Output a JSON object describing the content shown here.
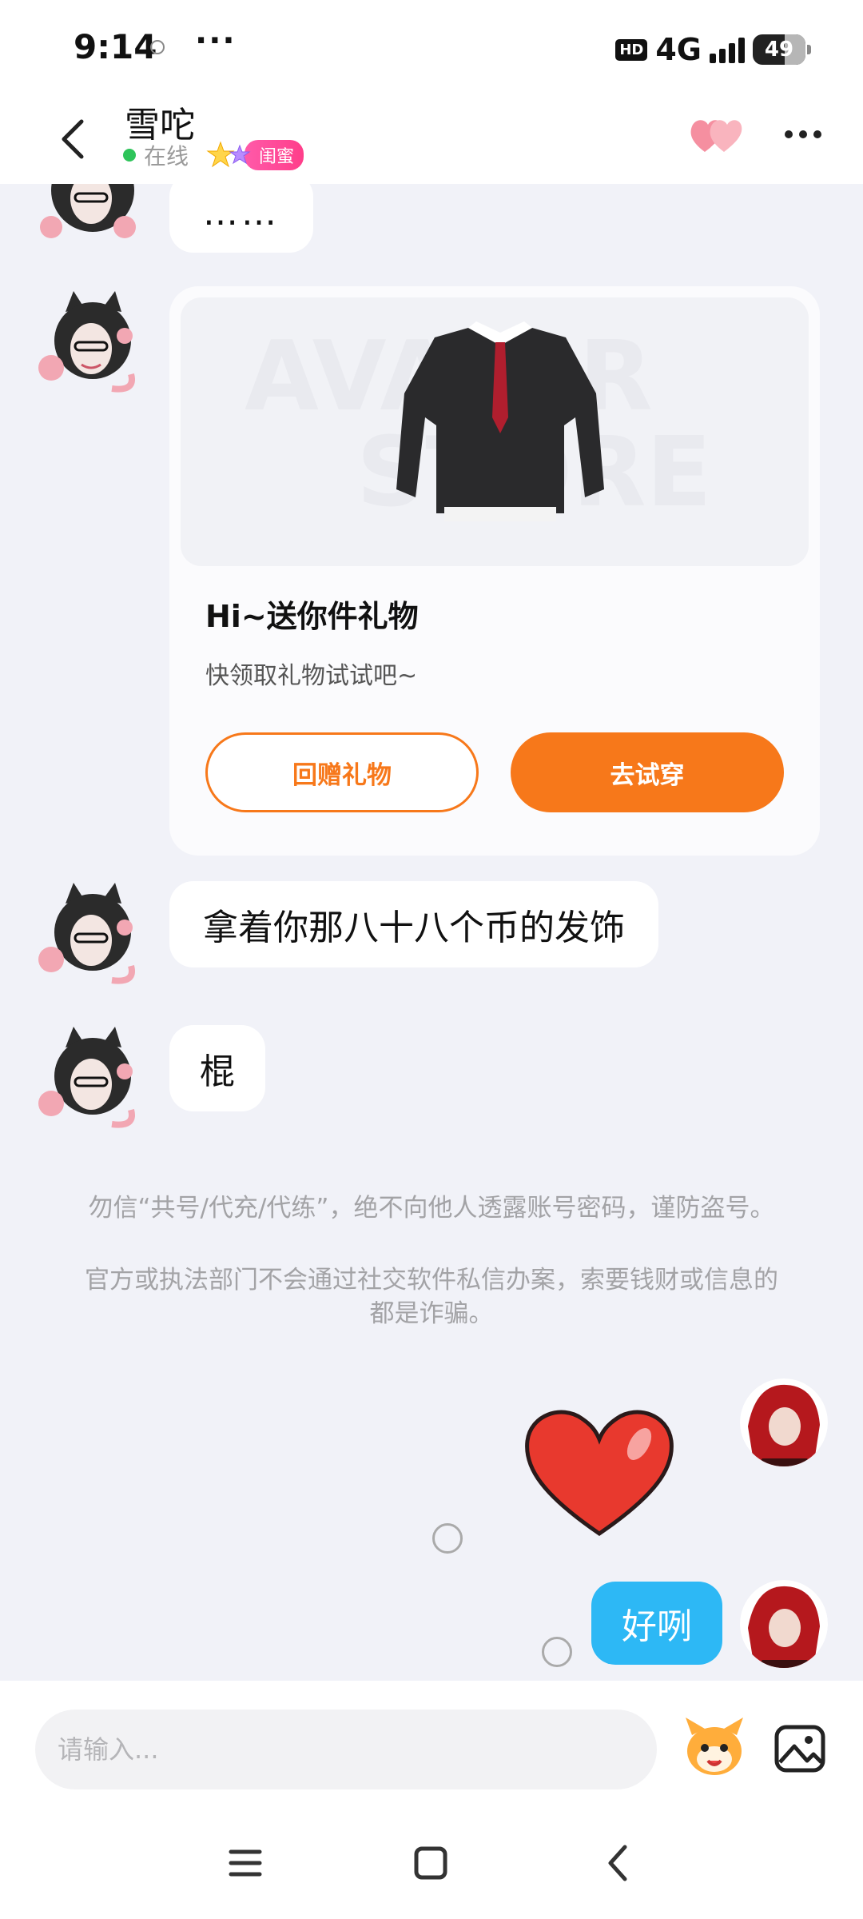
{
  "status_bar": {
    "time": "9:14",
    "hd": "HD",
    "network": "4G",
    "battery": "49"
  },
  "header": {
    "name": "雪咜",
    "status": "在线",
    "badge": "闺蜜"
  },
  "messages": {
    "ellipsis": "……",
    "gift_card": {
      "title": "Hi~送你件礼物",
      "description": "快领取礼物试试吧~",
      "return_gift_label": "回赠礼物",
      "try_on_label": "去试穿"
    },
    "text_1": "拿着你那八十八个币的发饰",
    "text_2": "棍",
    "mine_text": "好咧"
  },
  "notices": {
    "line_1": "勿信“共号/代充/代练”，绝不向他人透露账号密码，谨防盗号。",
    "line_2": "官方或执法部门不会通过社交软件私信办案，索要钱财或信息的都是诈骗。"
  },
  "input": {
    "placeholder": "请输入..."
  },
  "colors": {
    "accent_orange": "#f7781a",
    "bubble_blue": "#2db8f5",
    "online_green": "#2ec45a",
    "badge_pink": "#ff3e8a"
  }
}
